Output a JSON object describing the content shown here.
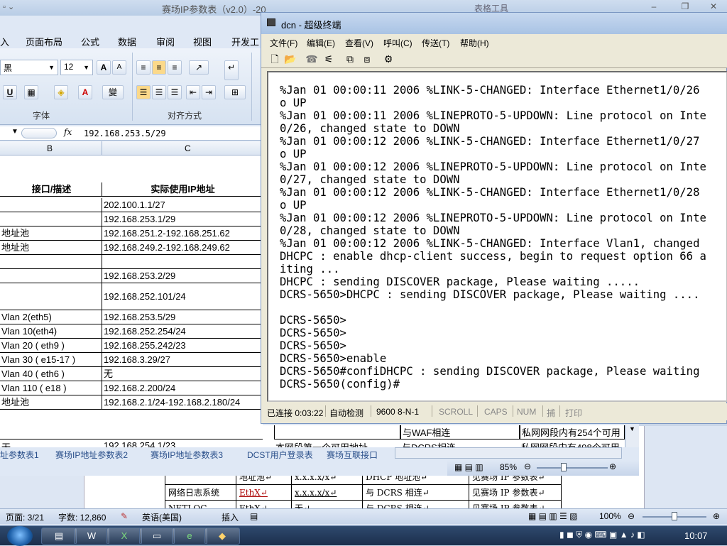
{
  "excel": {
    "title": "赛场IP参数表（v2.0）-20",
    "right_title_fragment": "表格工具",
    "ribbon_tabs": [
      "入",
      "页面布局",
      "公式",
      "数据",
      "审阅",
      "视图",
      "开发工"
    ],
    "font_name": "黑",
    "font_size": "12",
    "grow_font": "A",
    "shrink_font": "A",
    "underline": "U",
    "font_color_glyph": "A",
    "phonetic_glyph": "變",
    "group_font": "字体",
    "group_align": "对齐方式",
    "fx": "fx",
    "formula_value": "192.168.253.5/29",
    "col_b": "B",
    "col_c": "C",
    "header_b": "接口/描述",
    "header_c": "实际使用IP地址",
    "rows": [
      {
        "b": "",
        "c": "202.100.1.1/27"
      },
      {
        "b": "",
        "c": "192.168.253.1/29"
      },
      {
        "b": "地址池",
        "c": "192.168.251.2-192.168.251.62"
      },
      {
        "b": "地址池",
        "c": "192.168.249.2-192.168.249.62"
      },
      {
        "b": "",
        "c": ""
      },
      {
        "b": "",
        "c": "192.168.253.2/29"
      },
      {
        "b": "",
        "c": "192.168.252.101/24"
      },
      {
        "b": "Vlan 2(eth5)",
        "c": "192.168.253.5/29"
      },
      {
        "b": "Vlan 10(eth4)",
        "c": "192.168.252.254/24"
      },
      {
        "b": "Vlan 20 ( eth9 )",
        "c": "192.168.255.242/23"
      },
      {
        "b": "Vlan 30 ( e15-17 )",
        "c": "192.168.3.29/27"
      },
      {
        "b": "Vlan 40 ( eth6 )",
        "c": "无"
      },
      {
        "b": "Vlan 110 ( e18 )",
        "c": "192.168.2.200/24"
      },
      {
        "b": "地址池",
        "c": "192.168.2.1/24-192.168.2.180/24"
      }
    ],
    "below_rows": [
      {
        "a": "",
        "b": "",
        "c": "与WAF相连",
        "d": "私网网段内有254个可用"
      },
      {
        "a": "无",
        "b": "192.168.254.1/23",
        "c2": "本网段第一个可用地址",
        "c": "与DCRS相连",
        "d": "私网网段内有498个可用"
      }
    ],
    "sheet_tabs": [
      "址参数表1",
      "赛场IP地址参数表2",
      "赛场IP地址参数表3",
      "DCST用户登录表",
      "赛场互联接口"
    ],
    "zoom": "85%"
  },
  "word": {
    "table_rows": [
      {
        "c1": "",
        "c2": "地址池↵",
        "c3": "x.x.x.x/x↵",
        "c4": "DHCP 地址池↵",
        "c5": "见赛场 IP 参数表↵"
      },
      {
        "c1": "网络日志系统",
        "c2": "EthX↵",
        "c3": "x.x.x.x/x↵",
        "c4": "与 DCRS 相连↵",
        "c5": "见赛场 IP 参数表↵"
      },
      {
        "c1": "NETLOG",
        "c2": "EthX↵",
        "c3": "无↵",
        "c4": "与 DCRS 相连↵",
        "c5": "见赛场 IP 参数表↵"
      }
    ],
    "status_page": "页面: 3/21",
    "status_words": "字数: 12,860",
    "status_lang": "英语(美国)",
    "status_insert": "插入",
    "zoom": "100%"
  },
  "terminal": {
    "title": "dcn - 超级终端",
    "menus": [
      "文件(F)",
      "编辑(E)",
      "查看(V)",
      "呼叫(C)",
      "传送(T)",
      "帮助(H)"
    ],
    "lines": [
      "%Jan 01 00:00:11 2006 %LINK-5-CHANGED: Interface Ethernet1/0/26",
      "o UP",
      "%Jan 01 00:00:11 2006 %LINEPROTO-5-UPDOWN: Line protocol on Inte",
      "0/26, changed state to DOWN",
      "%Jan 01 00:00:12 2006 %LINK-5-CHANGED: Interface Ethernet1/0/27",
      "o UP",
      "%Jan 01 00:00:12 2006 %LINEPROTO-5-UPDOWN: Line protocol on Inte",
      "0/27, changed state to DOWN",
      "%Jan 01 00:00:12 2006 %LINK-5-CHANGED: Interface Ethernet1/0/28",
      "o UP",
      "%Jan 01 00:00:12 2006 %LINEPROTO-5-UPDOWN: Line protocol on Inte",
      "0/28, changed state to DOWN",
      "%Jan 01 00:00:12 2006 %LINK-5-CHANGED: Interface Vlan1, changed",
      "DHCPC : enable dhcp-client success, begin to request option 66 a",
      "iting ...",
      "DHCPC : sending DISCOVER package, Please waiting .....",
      "DCRS-5650>DHCPC : sending DISCOVER package, Please waiting ....",
      "",
      "DCRS-5650>",
      "DCRS-5650>",
      "DCRS-5650>",
      "DCRS-5650>enable",
      "DCRS-5650#confiDHCPC : sending DISCOVER package, Please waiting",
      "DCRS-5650(config)#"
    ],
    "status": {
      "connected": "已连接 0:03:22",
      "detect": "自动检测",
      "baud": "9600 8-N-1",
      "scroll": "SCROLL",
      "caps": "CAPS",
      "num": "NUM",
      "capture": "捕",
      "print": "打印"
    }
  },
  "taskbar": {
    "clock": "10:07"
  }
}
